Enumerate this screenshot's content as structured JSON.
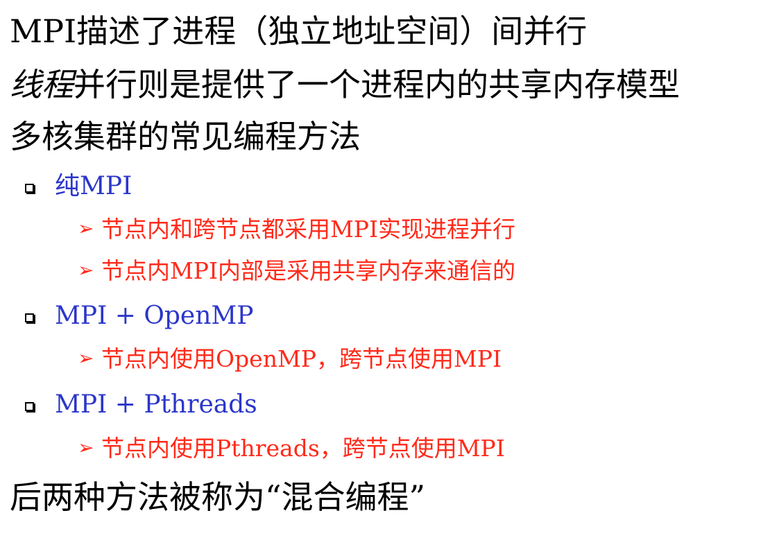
{
  "slide": {
    "line1": "MPI描述了进程（独立地址空间）间并行",
    "line2_italic": "线程",
    "line2_rest": "并行则是提供了一个进程内的共享内存模型",
    "line3": "多核集群的常见编程方法",
    "methods": [
      {
        "label": "纯MPI",
        "subs": [
          "节点内和跨节点都采用MPI实现进程并行",
          "节点内MPI内部是采用共享内存来通信的"
        ]
      },
      {
        "label": "MPI + OpenMP",
        "subs": [
          "节点内使用OpenMP，跨节点使用MPI"
        ]
      },
      {
        "label": "MPI + Pthreads",
        "subs": [
          "节点内使用Pthreads，跨节点使用MPI"
        ]
      }
    ],
    "conclusion": "后两种方法被称为“混合编程”"
  },
  "icons": {
    "bullet": "hollow-square-bullet-icon",
    "sub_bullet": "arrowhead-bullet-icon",
    "sub_bullet_glyph": "➢"
  },
  "colors": {
    "main_text": "#000000",
    "method_text": "#2b36c9",
    "sub_text": "#ff2a1a"
  }
}
